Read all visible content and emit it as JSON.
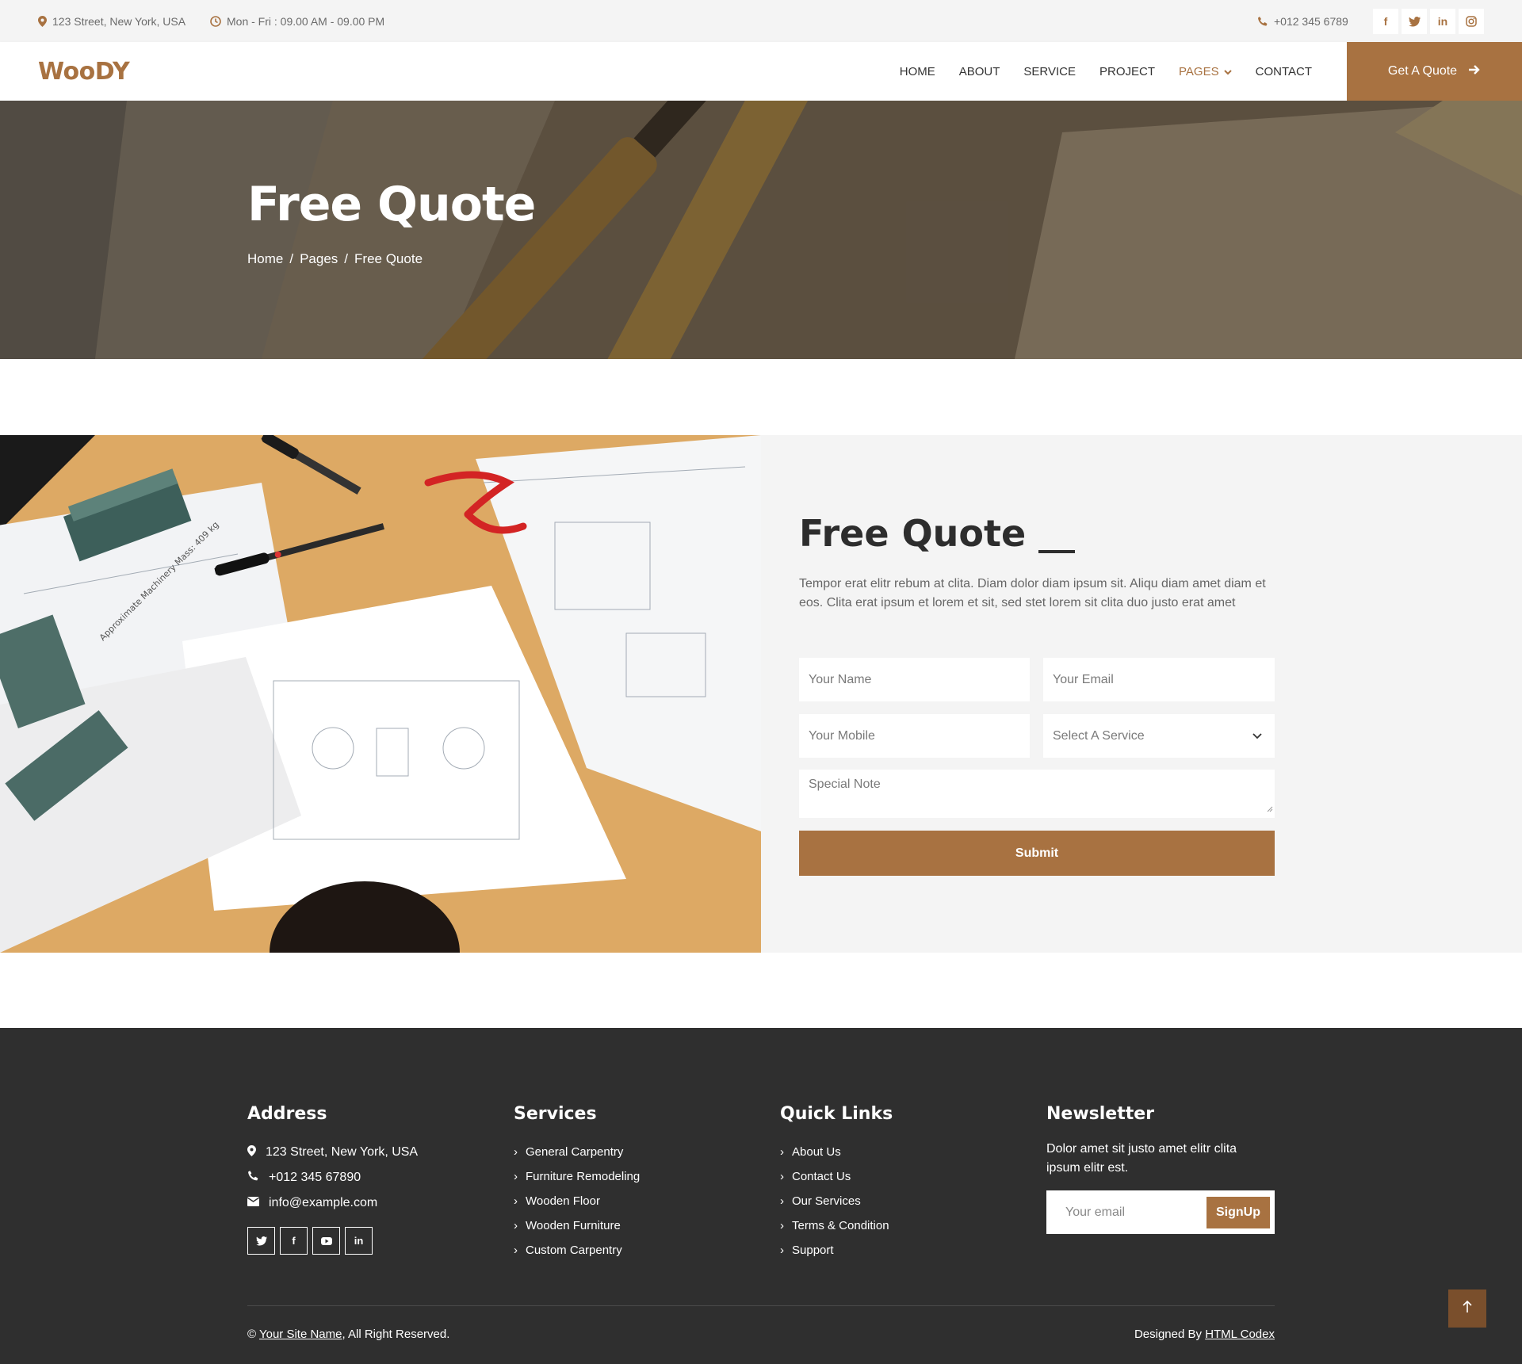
{
  "topbar": {
    "address": "123 Street, New York, USA",
    "hours": "Mon - Fri : 09.00 AM - 09.00 PM",
    "phone": "+012 345 6789",
    "social": [
      "f",
      "t",
      "in",
      "ig"
    ]
  },
  "nav": {
    "logo": "WooDY",
    "items": [
      "HOME",
      "ABOUT",
      "SERVICE",
      "PROJECT",
      "PAGES",
      "CONTACT"
    ],
    "active_index": 4,
    "cta": "Get A Quote"
  },
  "hero": {
    "title": "Free Quote",
    "breadcrumb": [
      "Home",
      "/",
      "Pages",
      "/",
      "Free Quote"
    ]
  },
  "quote": {
    "title": "Free Quote",
    "text": "Tempor erat elitr rebum at clita. Diam dolor diam ipsum sit. Aliqu diam amet diam et eos. Clita erat ipsum et lorem et sit, sed stet lorem sit clita duo justo erat amet",
    "form": {
      "name_placeholder": "Your Name",
      "email_placeholder": "Your Email",
      "mobile_placeholder": "Your Mobile",
      "service_selected": "Select A Service",
      "note_placeholder": "Special Note",
      "submit": "Submit"
    },
    "image_text": "Approximate Machinery Mass: 409 kg"
  },
  "footer": {
    "address": {
      "title": "Address",
      "street": "123 Street, New York, USA",
      "phone": "+012 345 67890",
      "email": "info@example.com"
    },
    "services": {
      "title": "Services",
      "items": [
        "General Carpentry",
        "Furniture Remodeling",
        "Wooden Floor",
        "Wooden Furniture",
        "Custom Carpentry"
      ]
    },
    "quick_links": {
      "title": "Quick Links",
      "items": [
        "About Us",
        "Contact Us",
        "Our Services",
        "Terms & Condition",
        "Support"
      ]
    },
    "newsletter": {
      "title": "Newsletter",
      "text": "Dolor amet sit justo amet elitr clita ipsum elitr est.",
      "placeholder": "Your email",
      "button": "SignUp"
    },
    "copyright_prefix": "©",
    "site_name": "Your Site Name",
    "rights": ", All Right Reserved.",
    "designed_by": "Designed By",
    "designer": "HTML Codex"
  },
  "colors": {
    "accent": "#a87241",
    "footer_bg": "#2f2f2f",
    "topbar_bg": "#f4f4f4"
  }
}
